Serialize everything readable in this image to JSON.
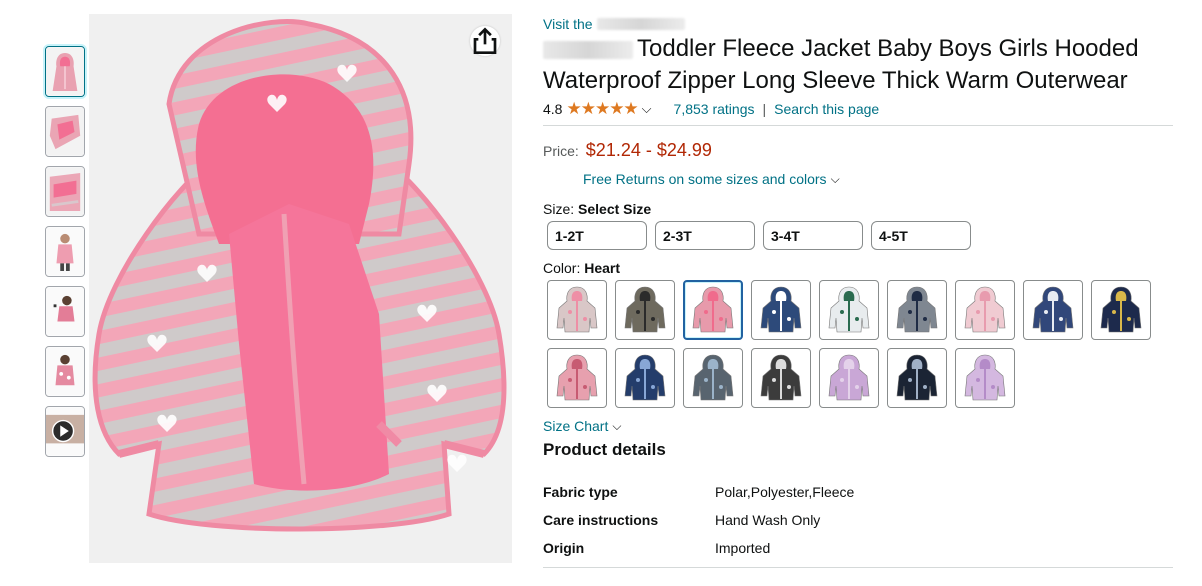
{
  "store": {
    "visit_prefix": "Visit the"
  },
  "product": {
    "title_line1": "Toddler Fleece Jacket Baby Boys Girls Hooded",
    "title_line2": "Waterproof Zipper Long Sleeve Thick Warm Outerwear"
  },
  "rating": {
    "value": "4.8",
    "stars": "★★★★★",
    "ratings_text": "7,853 ratings",
    "separator": "|",
    "search_text": "Search this page"
  },
  "price": {
    "label": "Price:",
    "range": "$21.24 - $24.99",
    "returns_text": "Free Returns on some sizes and colors"
  },
  "size": {
    "label": "Size:",
    "selected": "Select Size",
    "options": [
      "1-2T",
      "2-3T",
      "3-4T",
      "4-5T"
    ]
  },
  "color": {
    "label": "Color:",
    "selected": "Heart",
    "selected_index": 2,
    "swatches": [
      {
        "name": "pink-gray",
        "base": "#d9c7c7",
        "accent": "#ee8fa6"
      },
      {
        "name": "leopard",
        "base": "#6e6a5e",
        "accent": "#2b2b2b"
      },
      {
        "name": "heart",
        "base": "#e79aab",
        "accent": "#f06b8c"
      },
      {
        "name": "navy-stars",
        "base": "#2d4a7a",
        "accent": "#ffffff"
      },
      {
        "name": "dino-white",
        "base": "#e8ecee",
        "accent": "#2a6b4f"
      },
      {
        "name": "gray-navy",
        "base": "#7f8791",
        "accent": "#1f2c45"
      },
      {
        "name": "pink-dots",
        "base": "#f0cbd2",
        "accent": "#e89bae"
      },
      {
        "name": "navy-white",
        "base": "#31477a",
        "accent": "#e9ecf2"
      },
      {
        "name": "navy-dino",
        "base": "#1d2a4c",
        "accent": "#d9b84a"
      },
      {
        "name": "pink-floral",
        "base": "#e7a0ae",
        "accent": "#c75b72"
      },
      {
        "name": "navy-print",
        "base": "#243d6b",
        "accent": "#88a7d6"
      },
      {
        "name": "gray-blue",
        "base": "#58646f",
        "accent": "#9bb3c9"
      },
      {
        "name": "black-white",
        "base": "#3c3c3c",
        "accent": "#dcdcdc"
      },
      {
        "name": "lilac",
        "base": "#c9a7d6",
        "accent": "#e4d2ea"
      },
      {
        "name": "navy-camo",
        "base": "#1b2434",
        "accent": "#a0b0c6"
      },
      {
        "name": "lavender",
        "base": "#d4b8e0",
        "accent": "#b48bc8"
      }
    ]
  },
  "size_chart": {
    "label": "Size Chart"
  },
  "details": {
    "title": "Product details",
    "rows": [
      {
        "key": "Fabric type",
        "value": "Polar,Polyester,Fleece"
      },
      {
        "key": "Care instructions",
        "value": "Hand Wash Only"
      },
      {
        "key": "Origin",
        "value": "Imported"
      }
    ]
  },
  "thumbnails": [
    {
      "name": "jacket-front",
      "selected": true
    },
    {
      "name": "jacket-flat",
      "selected": false
    },
    {
      "name": "jacket-detail",
      "selected": false
    },
    {
      "name": "child-model-1",
      "selected": false
    },
    {
      "name": "child-model-2",
      "selected": false
    },
    {
      "name": "child-model-3",
      "selected": false
    },
    {
      "name": "video",
      "selected": false
    }
  ],
  "colors": {
    "link": "#007185",
    "price": "#b12704",
    "star": "#de7921",
    "selected_border": "#2162a1"
  }
}
